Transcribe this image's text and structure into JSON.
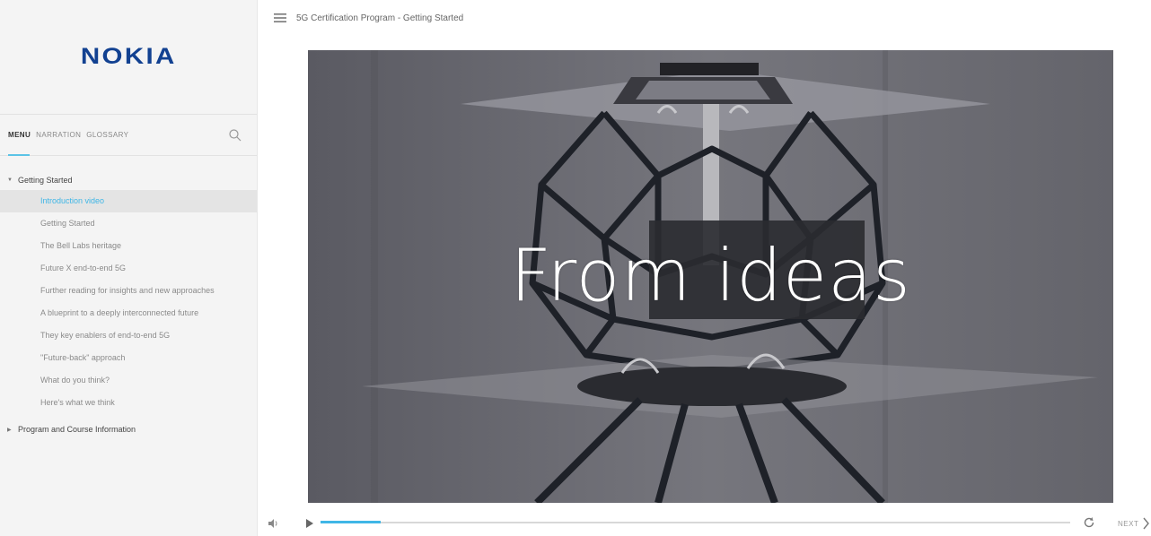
{
  "brand": {
    "logo_text": "NOKIA",
    "logo_color": "#124191"
  },
  "sidebar": {
    "tabs": [
      {
        "label": "MENU",
        "active": true
      },
      {
        "label": "NARRATION",
        "active": false
      },
      {
        "label": "GLOSSARY",
        "active": false
      }
    ],
    "search_icon": "search-icon",
    "sections": [
      {
        "label": "Getting Started",
        "expanded": true,
        "items": [
          {
            "label": "Introduction video",
            "active": true
          },
          {
            "label": "Getting Started"
          },
          {
            "label": "The Bell Labs heritage"
          },
          {
            "label": "Future X end-to-end 5G"
          },
          {
            "label": "Further reading for insights and new approaches"
          },
          {
            "label": "A blueprint to a deeply interconnected future"
          },
          {
            "label": "They key enablers of end-to-end 5G"
          },
          {
            "label": "\"Future-back\" approach"
          },
          {
            "label": "What do you think?"
          },
          {
            "label": "Here's what we think"
          }
        ]
      },
      {
        "label": "Program and Course Information",
        "expanded": false,
        "items": []
      }
    ]
  },
  "header": {
    "title": "5G Certification Program - Getting Started",
    "menu_icon": "hamburger-icon"
  },
  "video": {
    "caption": "From ideas",
    "progress": 0.08
  },
  "controls": {
    "volume_icon": "volume-icon",
    "play_icon": "play-icon",
    "replay_icon": "replay-icon",
    "next_label": "NEXT",
    "accent_color": "#3fb6e6"
  }
}
